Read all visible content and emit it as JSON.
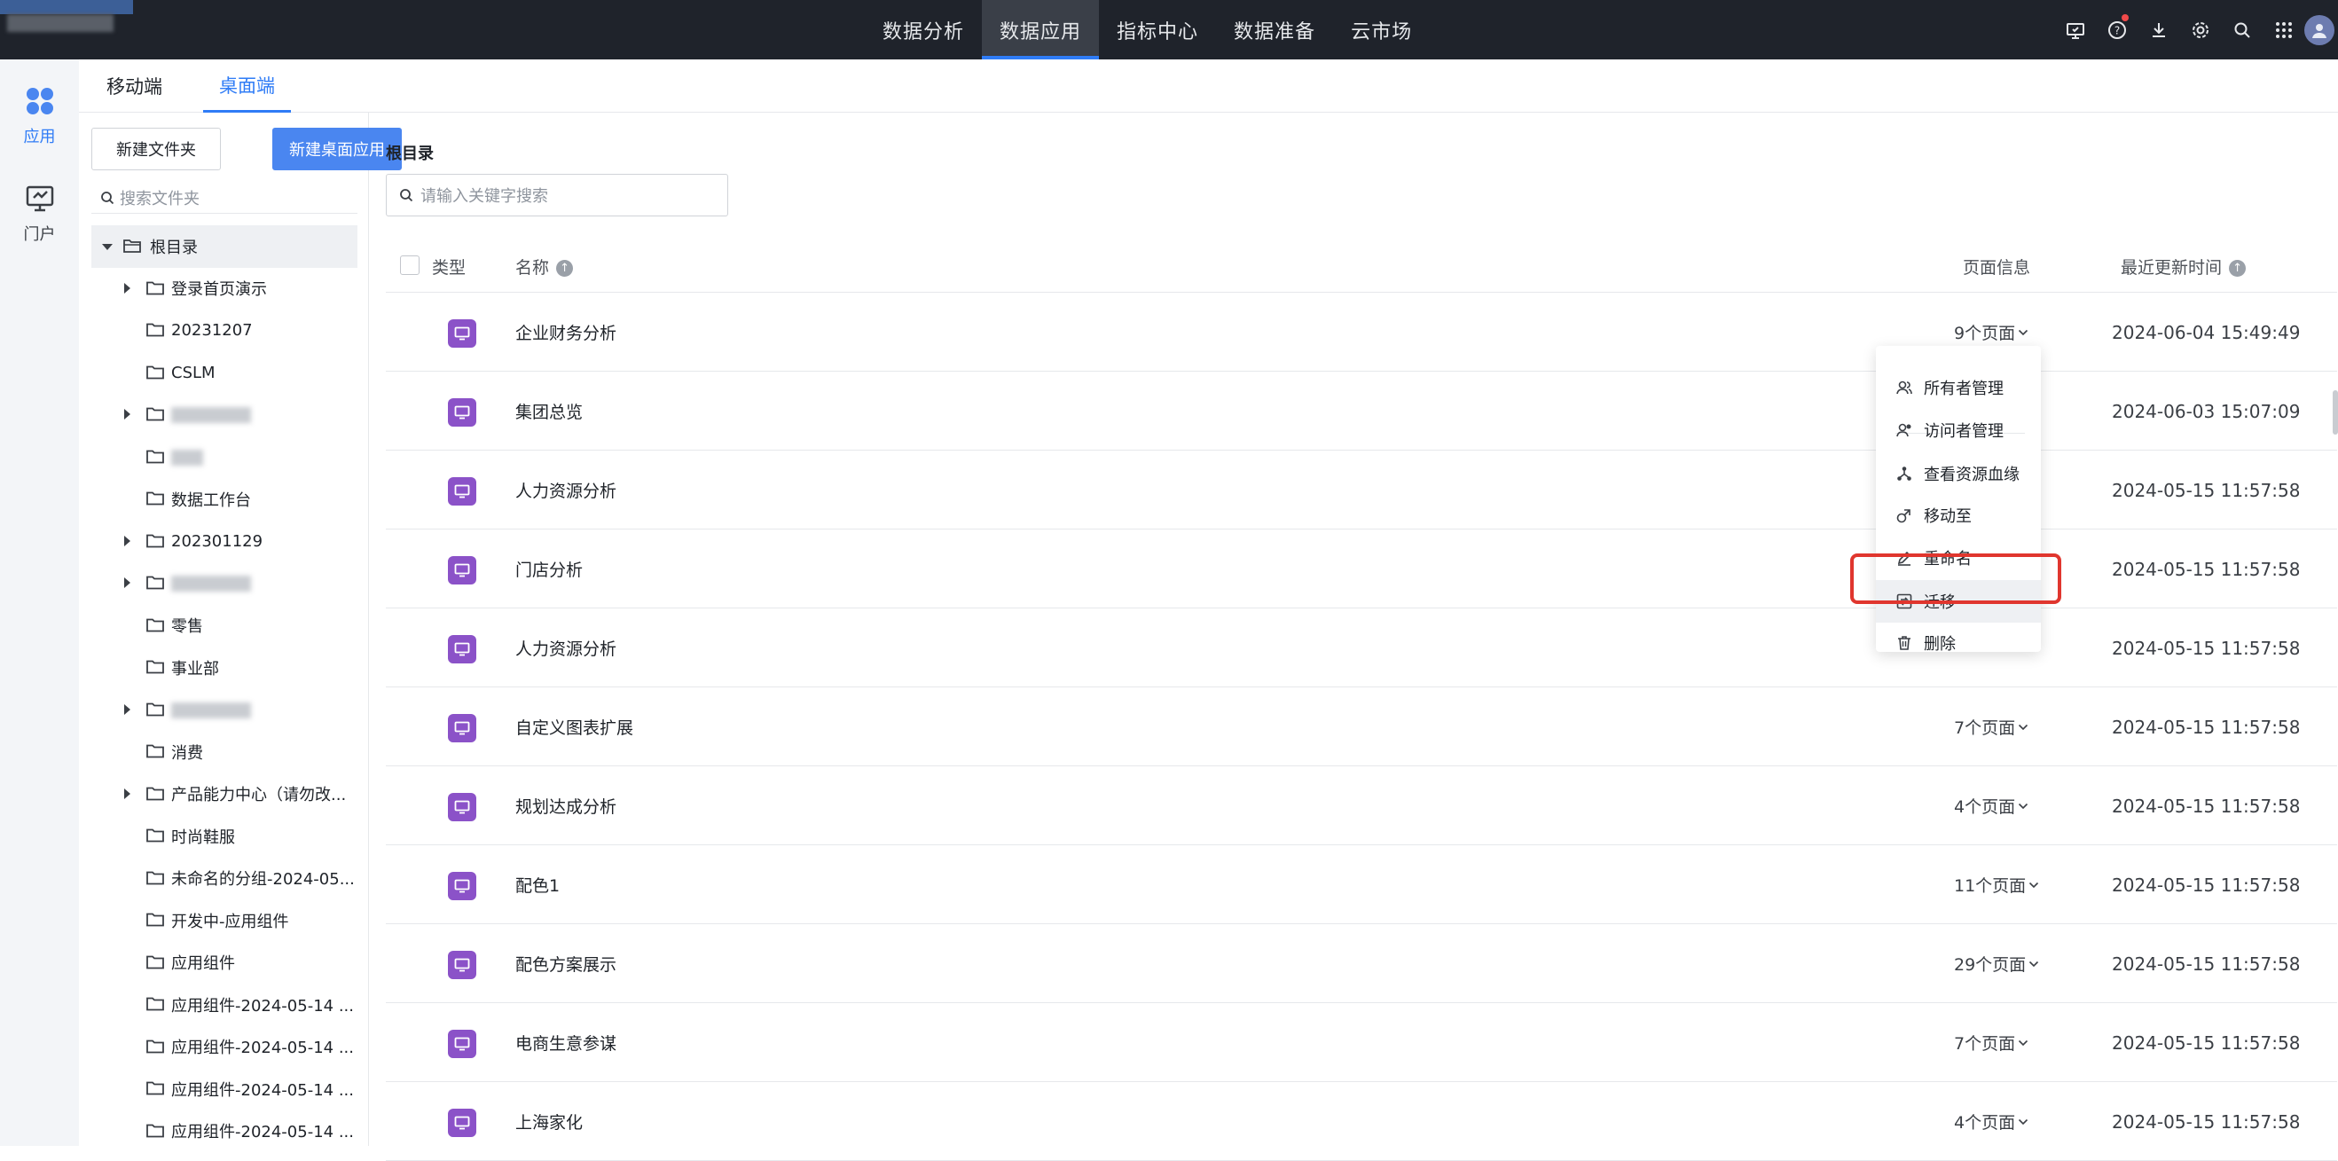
{
  "topbar": {
    "nav": [
      "数据分析",
      "数据应用",
      "指标中心",
      "数据准备",
      "云市场"
    ],
    "active_nav": "数据应用",
    "icons": [
      "screen-icon",
      "help-icon",
      "download-icon",
      "settings-icon",
      "search-icon",
      "apps-grid-icon",
      "avatar"
    ]
  },
  "rail": {
    "items": [
      {
        "label": "应用",
        "icon": "apps-icon",
        "active": true
      },
      {
        "label": "门户",
        "icon": "portal-icon",
        "active": false
      }
    ]
  },
  "tabs": {
    "mobile": "移动端",
    "desktop": "桌面端",
    "active": "桌面端"
  },
  "folders": {
    "new_folder_button": "新建文件夹",
    "new_app_button": "新建桌面应用",
    "search_placeholder": "搜索文件夹",
    "root": "根目录",
    "items": [
      {
        "label": "登录首页演示",
        "expandable": true
      },
      {
        "label": "20231207",
        "expandable": false
      },
      {
        "label": "CSLM",
        "expandable": false
      },
      {
        "label": "",
        "expandable": true,
        "blurred": true
      },
      {
        "label": "",
        "expandable": false,
        "blurred": true
      },
      {
        "label": "数据工作台",
        "expandable": false
      },
      {
        "label": "202301129",
        "expandable": true
      },
      {
        "label": "",
        "expandable": true,
        "blurred": true
      },
      {
        "label": "零售",
        "expandable": false
      },
      {
        "label": "事业部",
        "expandable": false
      },
      {
        "label": "",
        "expandable": true,
        "blurred": true
      },
      {
        "label": "消费",
        "expandable": false
      },
      {
        "label": "产品能力中心（请勿改...",
        "expandable": true
      },
      {
        "label": "时尚鞋服",
        "expandable": false
      },
      {
        "label": "未命名的分组-2024-05...",
        "expandable": false
      },
      {
        "label": "开发中-应用组件",
        "expandable": false
      },
      {
        "label": "应用组件",
        "expandable": false
      },
      {
        "label": "应用组件-2024-05-14 ...",
        "expandable": false
      },
      {
        "label": "应用组件-2024-05-14 ...",
        "expandable": false
      },
      {
        "label": "应用组件-2024-05-14 ...",
        "expandable": false
      },
      {
        "label": "应用组件-2024-05-14 ...",
        "expandable": false
      }
    ]
  },
  "main": {
    "breadcrumb": "根目录",
    "search_placeholder": "请输入关键字搜索",
    "columns": {
      "type": "类型",
      "name": "名称",
      "pages": "页面信息",
      "updated": "最近更新时间"
    },
    "rows": [
      {
        "name": "企业财务分析",
        "pages": "9个页面",
        "updated": "2024-06-04 15:49:49"
      },
      {
        "name": "集团总览",
        "pages": "",
        "updated": "2024-06-03 15:07:09"
      },
      {
        "name": "人力资源分析",
        "pages": "",
        "updated": "2024-05-15 11:57:58"
      },
      {
        "name": "门店分析",
        "pages": "",
        "updated": "2024-05-15 11:57:58"
      },
      {
        "name": "人力资源分析",
        "pages": "",
        "updated": "2024-05-15 11:57:58"
      },
      {
        "name": "自定义图表扩展",
        "pages": "7个页面",
        "updated": "2024-05-15 11:57:58"
      },
      {
        "name": "规划达成分析",
        "pages": "4个页面",
        "updated": "2024-05-15 11:57:58"
      },
      {
        "name": "配色1",
        "pages": "11个页面",
        "updated": "2024-05-15 11:57:58"
      },
      {
        "name": "配色方案展示",
        "pages": "29个页面",
        "updated": "2024-05-15 11:57:58"
      },
      {
        "name": "电商生意参谋",
        "pages": "7个页面",
        "updated": "2024-05-15 11:57:58"
      },
      {
        "name": "上海家化",
        "pages": "4个页面",
        "updated": "2024-05-15 11:57:58"
      }
    ]
  },
  "context_menu": {
    "items": [
      {
        "label": "所有者管理",
        "icon": "owner-icon"
      },
      {
        "label": "访问者管理",
        "icon": "visitor-icon"
      },
      {
        "label": "查看资源血缘",
        "icon": "lineage-icon"
      },
      {
        "label": "移动至",
        "icon": "move-icon"
      },
      {
        "label": "重命名",
        "icon": "rename-icon"
      },
      {
        "label": "迁移",
        "icon": "migrate-icon",
        "highlighted": true
      },
      {
        "label": "删除",
        "icon": "delete-icon"
      }
    ],
    "highlight_color": "#e0362e"
  },
  "colors": {
    "accent": "#2f7cf6",
    "primary_button": "#4a86f0",
    "app_icon": "#8b52c8",
    "topbar": "#1f232b"
  }
}
